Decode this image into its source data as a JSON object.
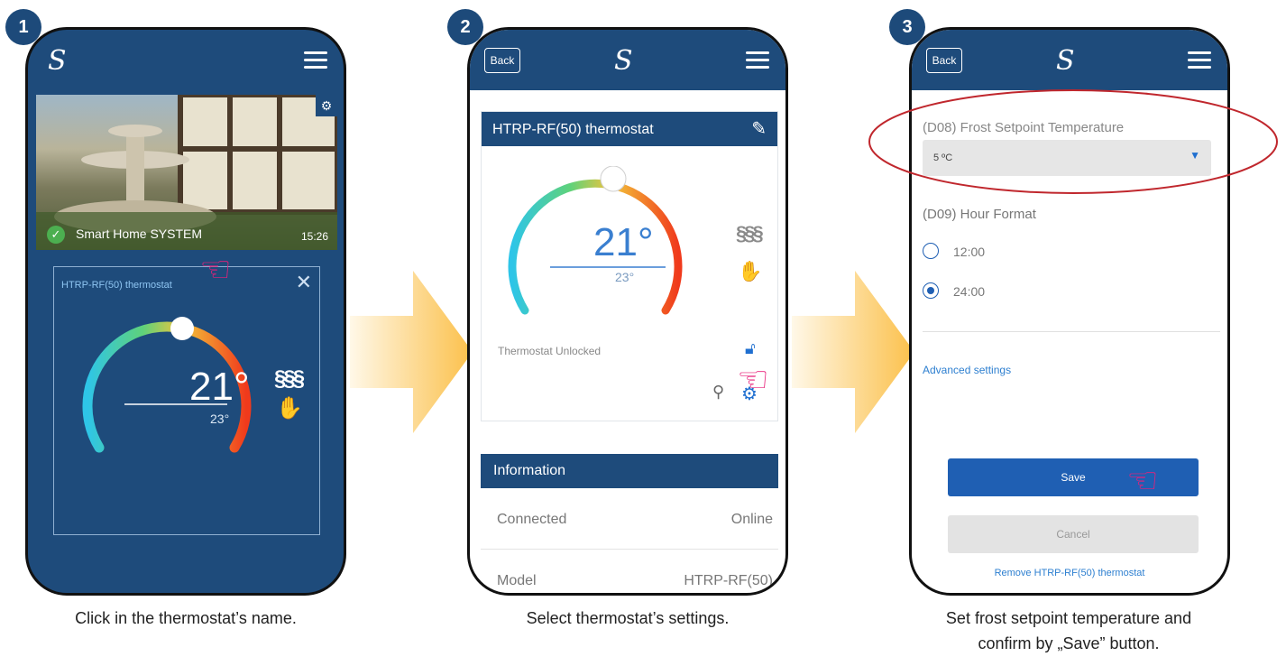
{
  "steps": [
    {
      "number": "1",
      "caption": "Click in the thermostat’s name."
    },
    {
      "number": "2",
      "caption": "Select thermostat’s settings."
    },
    {
      "number": "3",
      "caption_line1": "Set frost setpoint temperature and",
      "caption_line2": "confirm by „Save” button."
    }
  ],
  "app": {
    "logo": "S",
    "back_label": "Back"
  },
  "screen1": {
    "camera_title": "Smart Home SYSTEM",
    "camera_time": "15:26",
    "thermostat_name": "HTRP-RF(50) thermostat",
    "current_temp": "21°",
    "set_temp": "23°"
  },
  "screen2": {
    "card_title": "HTRP-RF(50) thermostat",
    "current_temp": "21°",
    "set_temp": "23°",
    "lock_status": "Thermostat Unlocked",
    "info_header": "Information",
    "info_rows": [
      {
        "label": "Connected",
        "value": "Online"
      },
      {
        "label": "Model",
        "value": "HTRP-RF(50)"
      }
    ]
  },
  "screen3": {
    "frost_label": "(D08) Frost Setpoint Temperature",
    "frost_value": "5 ºC",
    "hour_format_label": "(D09) Hour Format",
    "option_12": "12:00",
    "option_24": "24:00",
    "selected_option": "24:00",
    "advanced_link": "Advanced settings",
    "save_label": "Save",
    "cancel_label": "Cancel",
    "remove_link": "Remove HTRP-RF(50) thermostat"
  },
  "colors": {
    "app_blue": "#1e4b7b",
    "button_blue": "#1f5fb3",
    "highlight_red": "#c0272d",
    "hand_pink": "#e8207a",
    "arrow_yellow": "#fbc04a"
  }
}
